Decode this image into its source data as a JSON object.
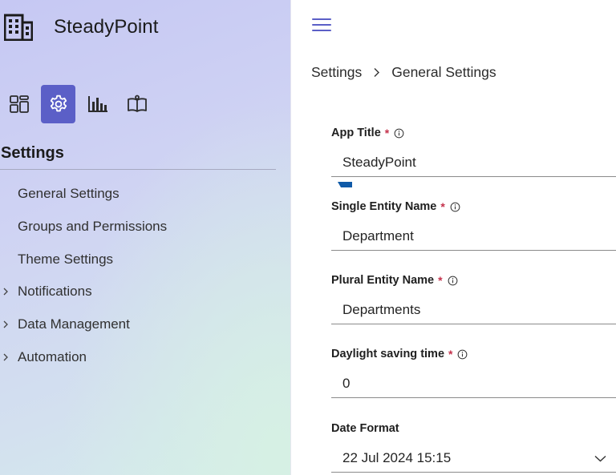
{
  "app": {
    "name": "SteadyPoint",
    "logo_icon": "building-icon",
    "accent_color": "#5b5fc7"
  },
  "icon_nav": [
    {
      "name": "dashboard-icon",
      "active": false
    },
    {
      "name": "gear-icon",
      "active": true
    },
    {
      "name": "bar-chart-icon",
      "active": false
    },
    {
      "name": "book-icon",
      "active": false
    }
  ],
  "sidebar": {
    "section_title": "Settings",
    "items": [
      {
        "label": "General Settings",
        "expandable": false
      },
      {
        "label": "Groups and Permissions",
        "expandable": false
      },
      {
        "label": "Theme Settings",
        "expandable": false
      },
      {
        "label": "Notifications",
        "expandable": true
      },
      {
        "label": "Data Management",
        "expandable": true
      },
      {
        "label": "Automation",
        "expandable": true
      }
    ]
  },
  "breadcrumb": {
    "root": "Settings",
    "current": "General Settings"
  },
  "form": {
    "fields": [
      {
        "label": "App Title",
        "required": "*",
        "value": "SteadyPoint"
      },
      {
        "label": "Single Entity Name",
        "required": "*",
        "value": "Department"
      },
      {
        "label": "Plural Entity Name",
        "required": "*",
        "value": "Departments"
      },
      {
        "label": "Daylight saving time",
        "required": "*",
        "value": "0"
      },
      {
        "label": "Date Format",
        "required": "",
        "value": "22 Jul 2024 15:15"
      }
    ]
  }
}
